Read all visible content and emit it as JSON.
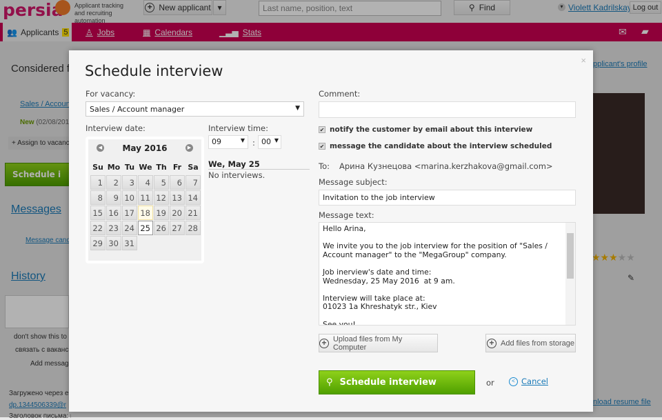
{
  "header": {
    "logo": "persia",
    "tagline": "Applicant tracking and recruiting automation",
    "new_applicant": "New applicant",
    "search_placeholder": "Last name, position, text",
    "find": "Find",
    "user": "Violett Kadrilskaya",
    "logout": "Log out"
  },
  "nav": {
    "items": [
      {
        "label": "Applicants",
        "badge": "5"
      },
      {
        "label": "Jobs"
      },
      {
        "label": "Calendars"
      },
      {
        "label": "Stats"
      }
    ]
  },
  "background": {
    "considered": "Considered f",
    "vacancy_link": "Sales / Account",
    "status": "New",
    "status_date": "(02/08/201",
    "assign": "+ Assign to vacanc",
    "schedule": "Schedule i",
    "messages": "Messages",
    "message_cand": "Message cand",
    "history": "History",
    "dont_show": "don't show this to",
    "link_vacancy": "связать с ваканс",
    "add_message": "Add messag",
    "uploaded": "Загружено через e",
    "email": "dp.1344506339@r",
    "subject_line": "Заголовок письма: пробное резюме",
    "profile_link": "pplicant's profile",
    "download": "nload resume file",
    "rating": 3,
    "rating_max": 5
  },
  "modal": {
    "title": "Schedule interview",
    "vacancy_label": "For vacancy:",
    "vacancy_value": "Sales / Account manager",
    "date_label": "Interview date:",
    "time_label": "Interview time:",
    "calendar": {
      "month": "May 2016",
      "weekdays": [
        "Su",
        "Mo",
        "Tu",
        "We",
        "Th",
        "Fr",
        "Sa"
      ],
      "weeks": [
        [
          "1",
          "2",
          "3",
          "4",
          "5",
          "6",
          "7"
        ],
        [
          "8",
          "9",
          "10",
          "11",
          "12",
          "13",
          "14"
        ],
        [
          "15",
          "16",
          "17",
          "18",
          "19",
          "20",
          "21"
        ],
        [
          "22",
          "23",
          "24",
          "25",
          "26",
          "27",
          "28"
        ],
        [
          "29",
          "30",
          "31",
          "",
          "",
          "",
          ""
        ]
      ],
      "today": "18",
      "selected": "25"
    },
    "hour": "09",
    "minute": "00",
    "time_sep": ":",
    "day_heading": "We, May 25",
    "day_status": "No interviews.",
    "comment_label": "Comment:",
    "comment_value": "",
    "notify_customer": "notify the customer by email about this interview",
    "notify_customer_checked": true,
    "message_candidate": "message the candidate about the interview scheduled",
    "message_candidate_checked": true,
    "to_label": "To:",
    "to_value": "Арина Кузнецова <marina.kerzhakova@gmail.com>",
    "subject_label": "Message subject:",
    "subject_value": "Invitation to the job interview",
    "text_label": "Message text:",
    "text_value": "Hello Arina,\n\nWe invite you to the job interview for the position of \"Sales / Account manager\" to the \"MegaGroup\" company.\n\nJob inerview's date and time:\nWednesday, 25 May 2016  at 9 am.\n\nInterview will take place at:\n01023 1a Khreshatyk str., Kiev\n\nSee you!",
    "upload": "Upload files from My Computer",
    "storage": "Add files from storage",
    "submit": "Schedule interview",
    "or": "or",
    "cancel": "Cancel",
    "close": "×"
  }
}
